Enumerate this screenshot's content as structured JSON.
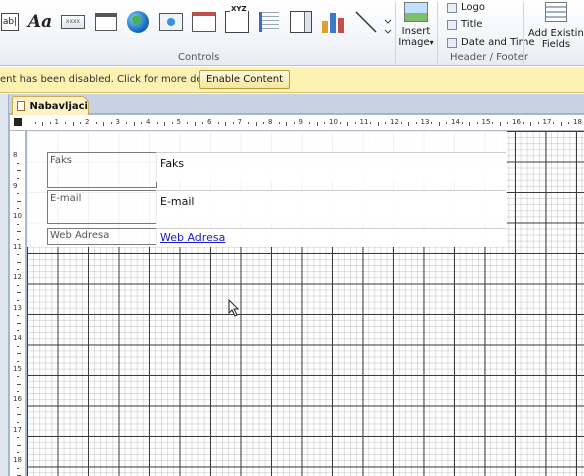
{
  "ribbon": {
    "controls_group_label": "Controls",
    "header_footer_group_label": "Header / Footer",
    "textbox_glyph": "ab|",
    "label_glyph": "Aa",
    "xyz_glyph": "XYZ",
    "insert_image_line1": "Insert",
    "insert_image_line2": "Image",
    "insert_image_arrow": "▾",
    "logo_label": "Logo",
    "title_label": "Title",
    "datetime_label": "Date and Time",
    "add_existing_line1": "Add Existing",
    "add_existing_line2": "Fields"
  },
  "security_bar": {
    "message": "ent has been disabled. Click for more details.",
    "enable_button": "Enable Content"
  },
  "document": {
    "tab_label": "Nabavljaci"
  },
  "rulers": {
    "horizontal": [
      "1",
      "2",
      "3",
      "4",
      "5",
      "6",
      "7",
      "8",
      "9",
      "10",
      "11",
      "12",
      "13",
      "14",
      "15",
      "16",
      "17",
      "18"
    ],
    "vertical": [
      "8",
      "9",
      "10",
      "11",
      "12",
      "13",
      "14",
      "15",
      "16",
      "17",
      "18"
    ]
  },
  "form": {
    "rows": [
      {
        "label": "Faks",
        "value": "Faks"
      },
      {
        "label": "E-mail",
        "value": "E-mail"
      },
      {
        "label": "Web Adresa",
        "value": "Web Adresa"
      }
    ]
  }
}
